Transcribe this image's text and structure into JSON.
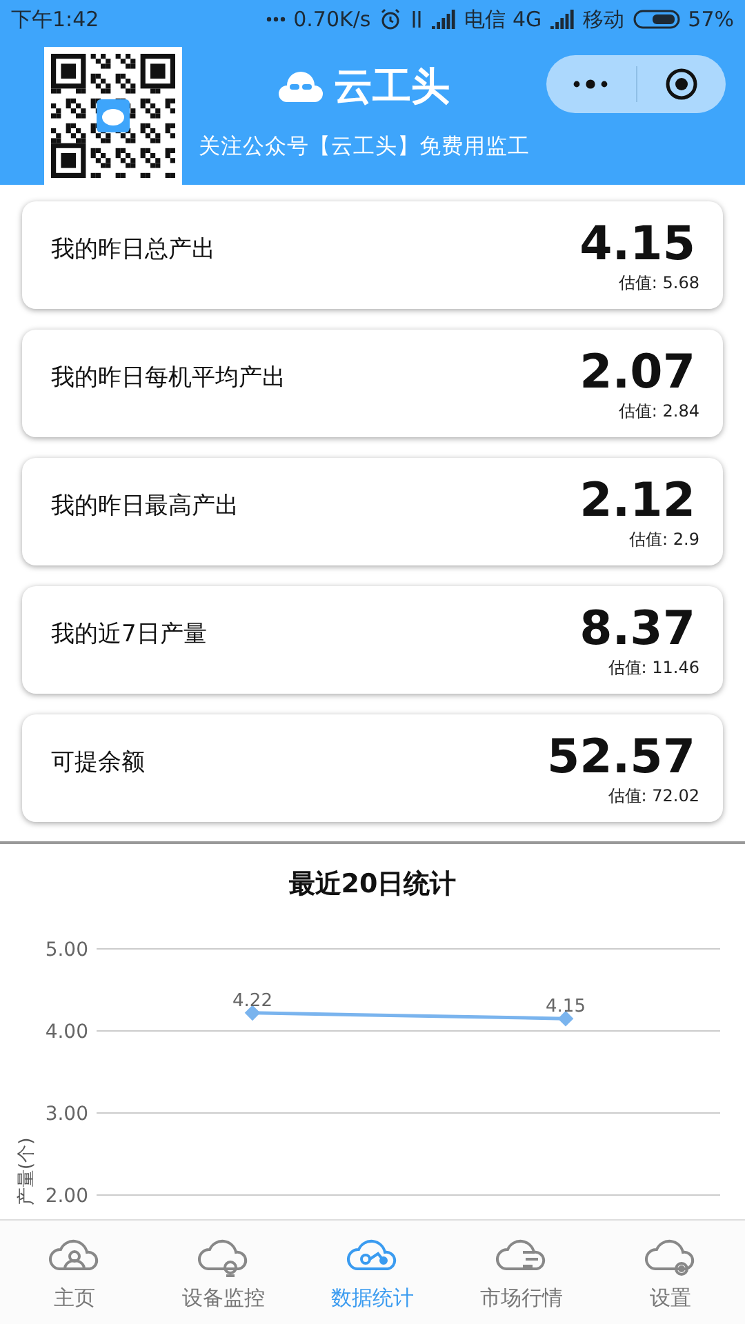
{
  "status_bar": {
    "time": "下午1:42",
    "speed": "0.70K/s",
    "carrier_1": "电信 4G",
    "carrier_2": "移动",
    "battery": "57%"
  },
  "header": {
    "title": "云工头",
    "subtitle": "关注公众号【云工头】免费用监工"
  },
  "stats": [
    {
      "label": "我的昨日总产出",
      "value": "4.15",
      "estimate": "估值: 5.68"
    },
    {
      "label": "我的昨日每机平均产出",
      "value": "2.07",
      "estimate": "估值: 2.84"
    },
    {
      "label": "我的昨日最高产出",
      "value": "2.12",
      "estimate": "估值: 2.9"
    },
    {
      "label": "我的近7日产量",
      "value": "8.37",
      "estimate": "估值: 11.46"
    },
    {
      "label": "可提余额",
      "value": "52.57",
      "estimate": "估值: 72.02"
    }
  ],
  "chart": {
    "chart_data": {
      "type": "line",
      "title": "最近20日统计",
      "ylabel": "产量(个)",
      "series": [
        {
          "color": "#7ab4ee",
          "marker": "diamond",
          "values": [
            4.22,
            4.15
          ]
        }
      ],
      "ylim": [
        2,
        5
      ],
      "yticks": [
        {
          "value": 2,
          "label": "2.00"
        },
        {
          "value": 3,
          "label": "3.00"
        },
        {
          "value": 4,
          "label": "4.00"
        },
        {
          "value": 5,
          "label": "5.00"
        }
      ],
      "data_labels": true
    }
  },
  "tab_bar": [
    {
      "kind": "home",
      "label": "主页",
      "selected": false
    },
    {
      "kind": "monitor",
      "label": "设备监控",
      "selected": false
    },
    {
      "kind": "stats",
      "label": "数据统计",
      "selected": true
    },
    {
      "kind": "market",
      "label": "市场行情",
      "selected": false
    },
    {
      "kind": "settings",
      "label": "设置",
      "selected": false
    }
  ]
}
